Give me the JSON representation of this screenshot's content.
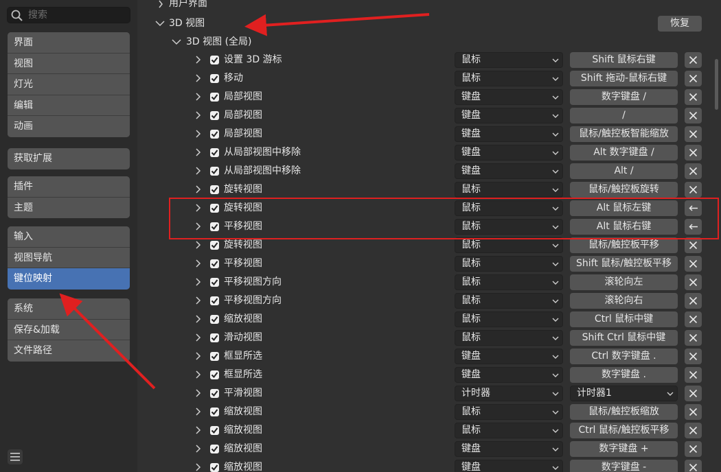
{
  "search": {
    "placeholder": "搜索",
    "value": ""
  },
  "sidebar": {
    "groups": [
      [
        "界面",
        "视图",
        "灯光",
        "编辑",
        "动画"
      ],
      [
        "获取扩展"
      ],
      [
        "插件",
        "主题"
      ],
      [
        "输入",
        "视图导航",
        "键位映射"
      ],
      [
        "系统",
        "保存&加载",
        "文件路径"
      ]
    ],
    "active": "键位映射"
  },
  "main": {
    "top_header": "用户界面",
    "section": "3D 视图",
    "restore_label": "恢复",
    "subsection": "3D 视图 (全局)"
  },
  "rows": [
    {
      "name": "设置 3D 游标",
      "type": "鼠标",
      "key": "Shift 鼠标右键",
      "action": "remove"
    },
    {
      "name": "移动",
      "type": "鼠标",
      "key": "Shift 拖动-鼠标右键",
      "action": "remove"
    },
    {
      "name": "局部视图",
      "type": "键盘",
      "key": "数字键盘 /",
      "action": "remove"
    },
    {
      "name": "局部视图",
      "type": "键盘",
      "key": "/",
      "action": "remove"
    },
    {
      "name": "局部视图",
      "type": "键盘",
      "key": "鼠标/触控板智能缩放",
      "action": "remove"
    },
    {
      "name": "从局部视图中移除",
      "type": "键盘",
      "key": "Alt 数字键盘 /",
      "action": "remove"
    },
    {
      "name": "从局部视图中移除",
      "type": "键盘",
      "key": "Alt /",
      "action": "remove"
    },
    {
      "name": "旋转视图",
      "type": "鼠标",
      "key": "鼠标/触控板旋转",
      "action": "remove"
    },
    {
      "name": "旋转视图",
      "type": "鼠标",
      "key": "Alt 鼠标左键",
      "action": "restore"
    },
    {
      "name": "平移视图",
      "type": "鼠标",
      "key": "Alt 鼠标右键",
      "action": "restore"
    },
    {
      "name": "旋转视图",
      "type": "鼠标",
      "key": "鼠标/触控板平移",
      "action": "remove"
    },
    {
      "name": "平移视图",
      "type": "鼠标",
      "key": "Shift 鼠标/触控板平移",
      "action": "remove"
    },
    {
      "name": "平移视图方向",
      "type": "鼠标",
      "key": "滚轮向左",
      "action": "remove"
    },
    {
      "name": "平移视图方向",
      "type": "鼠标",
      "key": "滚轮向右",
      "action": "remove"
    },
    {
      "name": "缩放视图",
      "type": "鼠标",
      "key": "Ctrl 鼠标中键",
      "action": "remove"
    },
    {
      "name": "滑动视图",
      "type": "鼠标",
      "key": "Shift Ctrl 鼠标中键",
      "action": "remove"
    },
    {
      "name": "框显所选",
      "type": "键盘",
      "key": "Ctrl 数字键盘 .",
      "action": "remove"
    },
    {
      "name": "框显所选",
      "type": "键盘",
      "key": "数字键盘 .",
      "action": "remove"
    },
    {
      "name": "平滑视图",
      "type": "计时器",
      "key": "计时器1",
      "key_dropdown": true,
      "action": "remove"
    },
    {
      "name": "缩放视图",
      "type": "鼠标",
      "key": "鼠标/触控板缩放",
      "action": "remove"
    },
    {
      "name": "缩放视图",
      "type": "鼠标",
      "key": "Ctrl 鼠标/触控板平移",
      "action": "remove"
    },
    {
      "name": "缩放视图",
      "type": "键盘",
      "key": "数字键盘 +",
      "action": "remove"
    },
    {
      "name": "缩放视图",
      "type": "键盘",
      "key": "数字键盘 -",
      "action": "remove"
    }
  ],
  "colors": {
    "active": "#4772b3",
    "annotation": "#e02020"
  },
  "icons": {
    "search": "search-icon",
    "menu": "hamburger-icon",
    "remove": "close-icon",
    "restore": "back-arrow-icon"
  }
}
